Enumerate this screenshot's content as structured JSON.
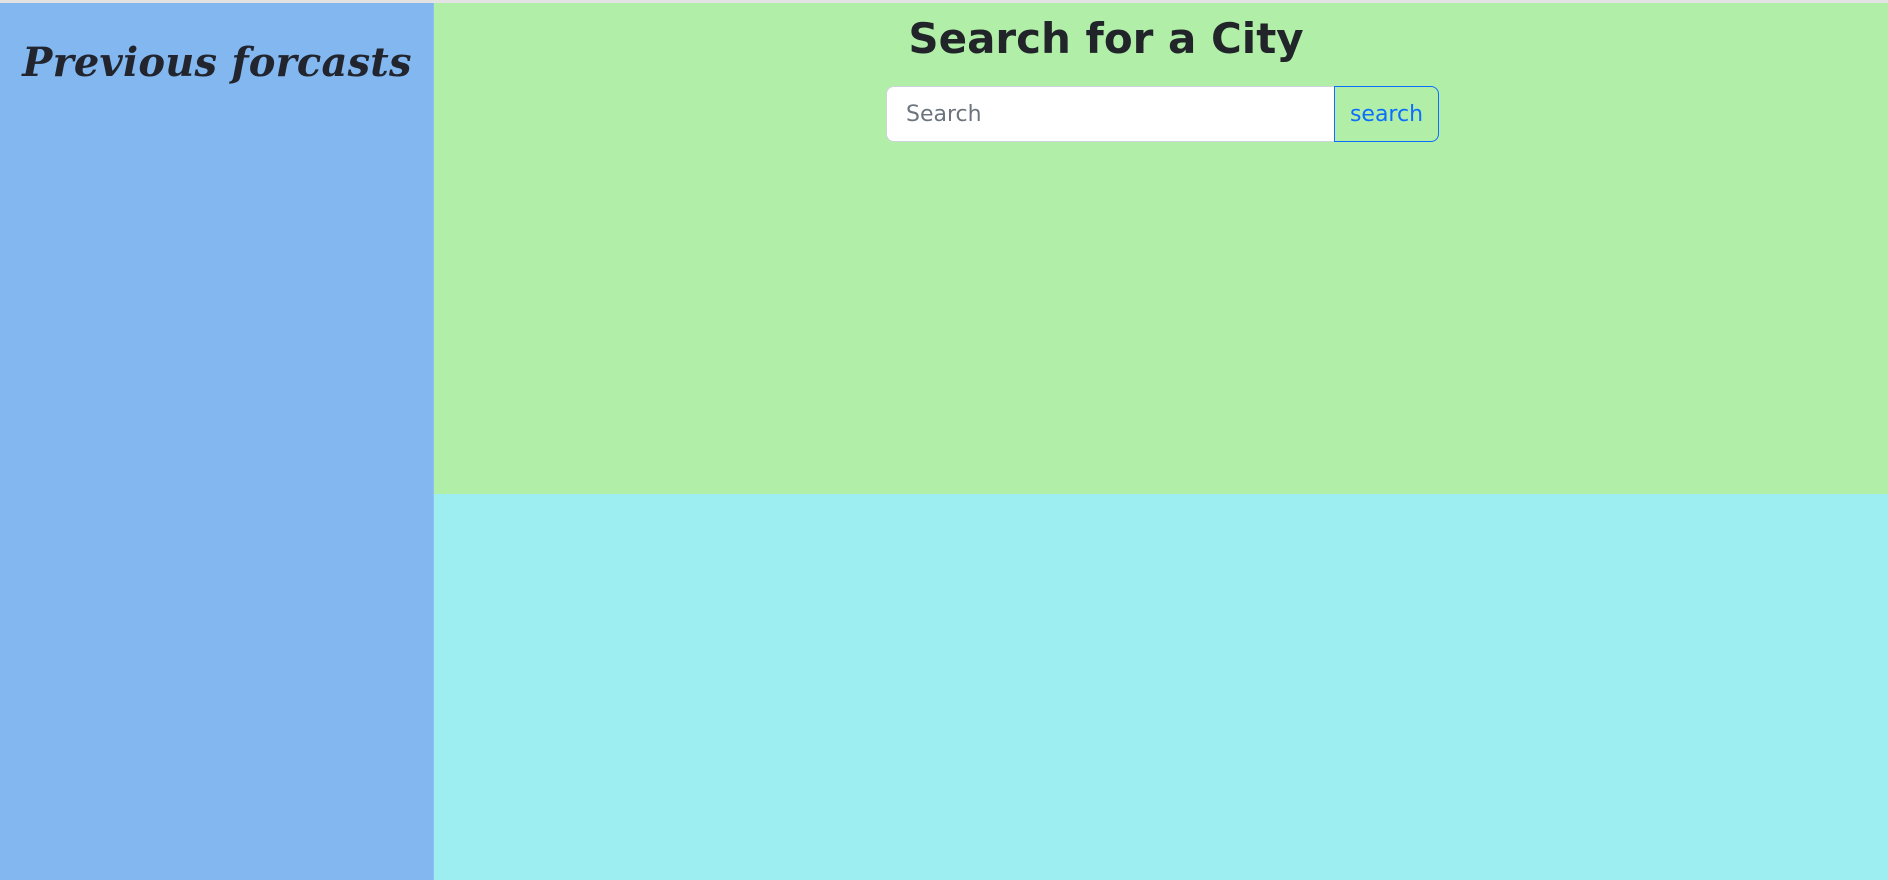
{
  "sidebar": {
    "title": "Previous forcasts"
  },
  "search": {
    "title": "Search for a City",
    "placeholder": "Search",
    "value": "",
    "button_label": "search"
  },
  "colors": {
    "sidebar_bg": "#82b8ef",
    "search_panel_bg": "#b1eea8",
    "results_panel_bg": "#9deef1",
    "button_accent": "#0d6efd"
  }
}
